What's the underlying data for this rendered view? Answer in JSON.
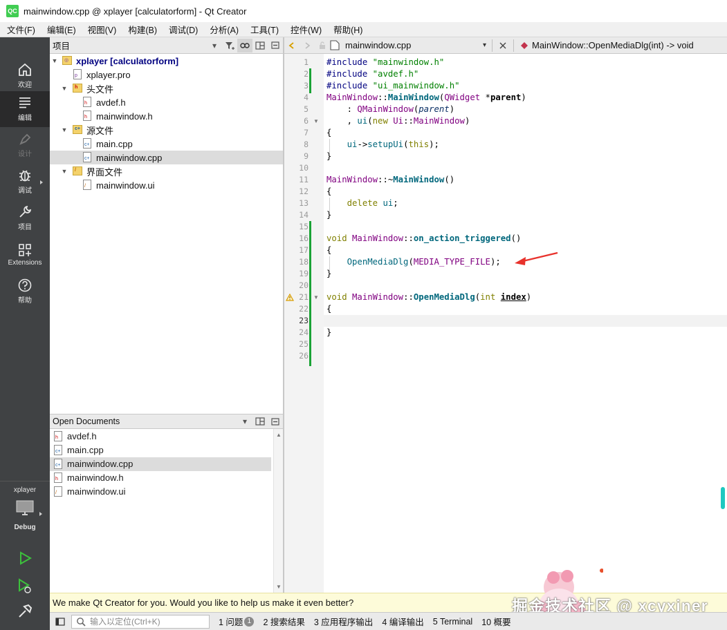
{
  "window": {
    "app_icon": "QC",
    "title": "mainwindow.cpp @ xplayer [calculatorform] - Qt Creator"
  },
  "menubar": {
    "items": [
      "文件(F)",
      "编辑(E)",
      "视图(V)",
      "构建(B)",
      "调试(D)",
      "分析(A)",
      "工具(T)",
      "控件(W)",
      "帮助(H)"
    ]
  },
  "modes": [
    {
      "label": "欢迎",
      "icon": "home-icon"
    },
    {
      "label": "编辑",
      "icon": "edit-icon"
    },
    {
      "label": "设计",
      "icon": "design-icon"
    },
    {
      "label": "调试",
      "icon": "bug-icon"
    },
    {
      "label": "项目",
      "icon": "wrench-icon"
    },
    {
      "label": "Extensions",
      "icon": "extensions-icon"
    },
    {
      "label": "帮助",
      "icon": "help-icon"
    }
  ],
  "kit": {
    "project": "xplayer",
    "build": "Debug"
  },
  "projects_panel": {
    "title": "项目",
    "root": "xplayer [calculatorform]",
    "items": {
      "pro": "xplayer.pro",
      "headers_folder": "头文件",
      "avdef_h": "avdef.h",
      "mainwindow_h": "mainwindow.h",
      "sources_folder": "源文件",
      "main_cpp": "main.cpp",
      "mainwindow_cpp": "mainwindow.cpp",
      "forms_folder": "界面文件",
      "mainwindow_ui": "mainwindow.ui"
    }
  },
  "open_documents": {
    "title": "Open Documents",
    "files": [
      "avdef.h",
      "main.cpp",
      "mainwindow.cpp",
      "mainwindow.h",
      "mainwindow.ui"
    ]
  },
  "editor": {
    "file": "mainwindow.cpp",
    "symbol": "MainWindow::OpenMediaDlg(int) -> void",
    "current_line": 23,
    "line_numbers": [
      "1",
      "2",
      "3",
      "4",
      "5",
      "6",
      "7",
      "8",
      "9",
      "10",
      "11",
      "12",
      "13",
      "14",
      "15",
      "16",
      "17",
      "18",
      "19",
      "20",
      "21",
      "22",
      "23",
      "24",
      "25",
      "26"
    ]
  },
  "info_bar": {
    "message": "We make Qt Creator for you. Would you like to help us make it even better?"
  },
  "statusbar": {
    "locator_placeholder": "输入以定位(Ctrl+K)",
    "panes": [
      {
        "label": "1  问题",
        "badge": "1"
      },
      {
        "label": "2  搜索结果"
      },
      {
        "label": "3  应用程序输出"
      },
      {
        "label": "4  编译输出"
      },
      {
        "label": "5  Terminal"
      },
      {
        "label": "10  概要"
      }
    ]
  },
  "watermark": "掘金技术社区 @ xcyxiner",
  "colors": {
    "modebar": "#404244",
    "keyword": "#808000",
    "string": "#008000",
    "function": "#00677c",
    "modified_marker": "#1aa335",
    "annotation_arrow": "#e8322c"
  }
}
